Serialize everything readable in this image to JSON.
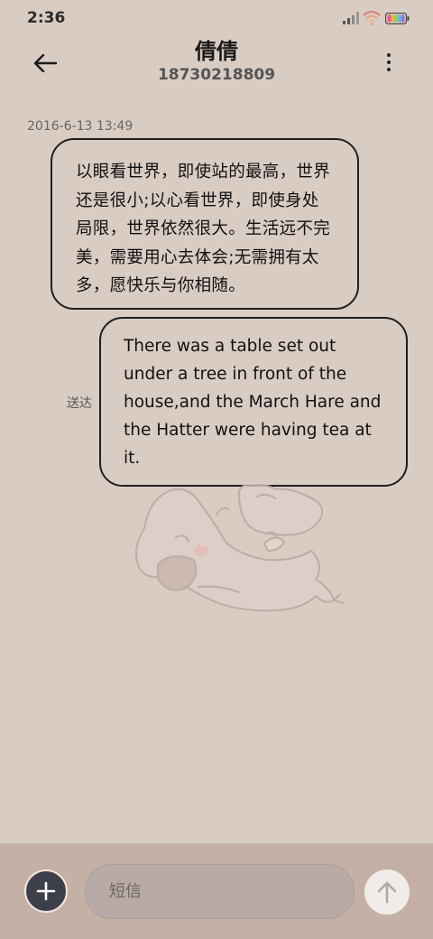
{
  "status_bar": {
    "time": "2:36",
    "icons": [
      "signal-icon",
      "wifi-icon",
      "battery-icon"
    ]
  },
  "header": {
    "contact_name": "倩倩",
    "phone_number": "18730218809",
    "icons": [
      "back-arrow-icon",
      "more-vertical-icon"
    ]
  },
  "conversation": {
    "timestamp": "2016-6-13 13:49",
    "incoming": [
      {
        "lines": [
          "以眼看世界，即使站的最高，世界",
          "还是很小;以心看世界，即使身处",
          "局限，世界依然很大。生活远不完",
          "美，需要用心去体会;无需拥有太",
          "多，愿快乐与你相随。"
        ]
      }
    ],
    "outgoing": [
      {
        "lines": [
          "There was a table set out",
          "under a tree in front of the",
          "house,and the March Hare and",
          "the Hatter were having tea at",
          "it."
        ],
        "status": "送达"
      }
    ]
  },
  "compose": {
    "placeholder": "短信",
    "value": "",
    "icons": [
      "plus-icon",
      "send-arrow-icon"
    ]
  },
  "colors": {
    "background": "#d9ccc3",
    "compose_bar": "#c4b0a4",
    "input_bg": "#b8aaa6",
    "add_button": "#3d3f4a",
    "send_button": "#f2ece9"
  }
}
